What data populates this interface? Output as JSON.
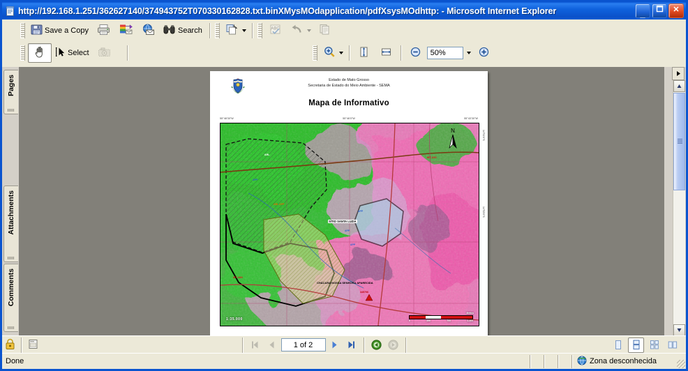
{
  "window": {
    "title": "http://192.168.1.251/362627140/374943752T070330162828.txt.binXMysMOdapplication/pdfXsysMOdhttp: - Microsoft Internet Explorer",
    "icon": "ie-document-icon",
    "buttons": {
      "minimize": "minimize-button",
      "maximize": "maximize-button",
      "close": "close-button"
    }
  },
  "toolbar_top": {
    "save_label": "Save a Copy",
    "search_label": "Search",
    "items": [
      {
        "name": "save-a-copy-button",
        "icon": "floppy-disk-icon",
        "label": "Save a Copy"
      },
      {
        "name": "print-button",
        "icon": "printer-icon",
        "label": ""
      },
      {
        "name": "email-export-button",
        "icon": "export-tray-icon",
        "label": ""
      },
      {
        "name": "email-button",
        "icon": "globe-envelope-icon",
        "label": ""
      },
      {
        "name": "search-button",
        "icon": "binoculars-icon",
        "label": "Search"
      },
      {
        "name": "copy-page-button",
        "icon": "page-copy-icon",
        "label": ""
      },
      {
        "name": "spellcheck-button",
        "icon": "abc-check-icon",
        "label": ""
      },
      {
        "name": "undo-button",
        "icon": "undo-arrow-icon",
        "label": ""
      },
      {
        "name": "document-properties-button",
        "icon": "document-lines-icon",
        "label": ""
      }
    ]
  },
  "toolbar_bottom": {
    "select_label": "Select",
    "zoom_value": "50%",
    "items": [
      {
        "name": "hand-tool-button",
        "icon": "hand-icon",
        "label": "",
        "state": "pressed"
      },
      {
        "name": "select-tool-button",
        "icon": "text-select-icon",
        "label": "Select",
        "state": "normal"
      },
      {
        "name": "snapshot-tool-button",
        "icon": "camera-icon",
        "label": "",
        "state": "disabled"
      },
      {
        "name": "zoom-in-tool-button",
        "icon": "magnifier-plus-icon",
        "label": "",
        "state": "normal"
      },
      {
        "name": "fit-page-button",
        "icon": "fit-height-icon",
        "label": "",
        "state": "normal"
      },
      {
        "name": "fit-width-button",
        "icon": "fit-width-icon",
        "label": "",
        "state": "normal"
      },
      {
        "name": "zoom-out-button",
        "icon": "minus-circle-icon",
        "label": "",
        "state": "normal"
      },
      {
        "name": "zoom-level-combo",
        "icon": "",
        "label": "50%",
        "state": "normal"
      },
      {
        "name": "zoom-increase-button",
        "icon": "plus-circle-icon",
        "label": "",
        "state": "normal"
      }
    ]
  },
  "sidebar": {
    "tabs": [
      {
        "label": "Pages",
        "name": "sidebar-tab-pages"
      },
      {
        "label": "Attachments",
        "name": "sidebar-tab-attachments"
      },
      {
        "label": "Comments",
        "name": "sidebar-tab-comments"
      }
    ]
  },
  "document": {
    "header_line1": "Estado de Mato Grosso",
    "header_line2": "Secretaria de Estado do Meio Ambiente - SEMA",
    "title": "Mapa de Informativo",
    "crest_alt": "coat-of-arms-mato-grosso",
    "top_coords": [
      "55°48'30\"W",
      "55°46'0\"W",
      "55°43'30\"W"
    ],
    "right_coords": [
      "14°51'0\"S",
      "14°53'0\"S"
    ],
    "scale_text": "1:35.000",
    "scalebar_units": "Metros",
    "scalebar_ticks": [
      "0",
      "350",
      "700",
      "1.400"
    ],
    "north_label": "N",
    "map_labels": [
      {
        "text": "ARL",
        "name": "map-label-arl-1"
      },
      {
        "text": "APP",
        "name": "map-label-app-1"
      },
      {
        "text": "ARL APP",
        "name": "map-label-arl-app"
      },
      {
        "text": "MT-220",
        "name": "map-label-road-mt220"
      },
      {
        "text": "MT-449",
        "name": "map-label-road-mt449"
      },
      {
        "text": "SÍTIO SANTA LUZIA",
        "name": "map-label-sitio-santa-luzia"
      },
      {
        "text": "APP",
        "name": "map-label-app-2"
      },
      {
        "text": "APP",
        "name": "map-label-app-3"
      },
      {
        "text": "APP",
        "name": "map-label-app-4"
      },
      {
        "text": "CHÁCARA NOSSA SENHORA APARECIDA",
        "name": "map-label-chacara"
      },
      {
        "text": "345706",
        "name": "map-label-parcel-number"
      }
    ]
  },
  "bottom_bar": {
    "page_indicator": "1 of 2",
    "security_icon": "lock-icon",
    "layout_icon": "page-layout-icon",
    "nav": [
      {
        "name": "first-page-button",
        "icon": "first-page-icon",
        "state": "disabled"
      },
      {
        "name": "previous-page-button",
        "icon": "previous-page-icon",
        "state": "disabled"
      },
      {
        "name": "page-number-field",
        "icon": "",
        "state": "normal"
      },
      {
        "name": "next-page-button",
        "icon": "next-page-icon",
        "state": "normal"
      },
      {
        "name": "last-page-button",
        "icon": "last-page-icon",
        "state": "normal"
      },
      {
        "name": "previous-view-button",
        "icon": "back-arrow-icon",
        "state": "normal"
      },
      {
        "name": "next-view-button",
        "icon": "forward-arrow-icon",
        "state": "disabled"
      }
    ],
    "view_modes": [
      {
        "name": "single-page-view-button",
        "icon": "single-page-icon",
        "state": "normal"
      },
      {
        "name": "continuous-view-button",
        "icon": "continuous-page-icon",
        "state": "selected"
      },
      {
        "name": "continuous-facing-view-button",
        "icon": "continuous-facing-icon",
        "state": "normal"
      },
      {
        "name": "facing-view-button",
        "icon": "facing-pages-icon",
        "state": "normal"
      }
    ]
  },
  "status_bar": {
    "message": "Done",
    "zone_label": "Zona desconhecida",
    "zone_icon": "globe-icon"
  },
  "colors": {
    "title_blue": "#0a54cf",
    "chrome": "#ece9d8",
    "doc_bg": "#828079",
    "accent_red": "#cc0000",
    "veg_green": "#17c017",
    "soil_magenta": "#e85fb0"
  }
}
